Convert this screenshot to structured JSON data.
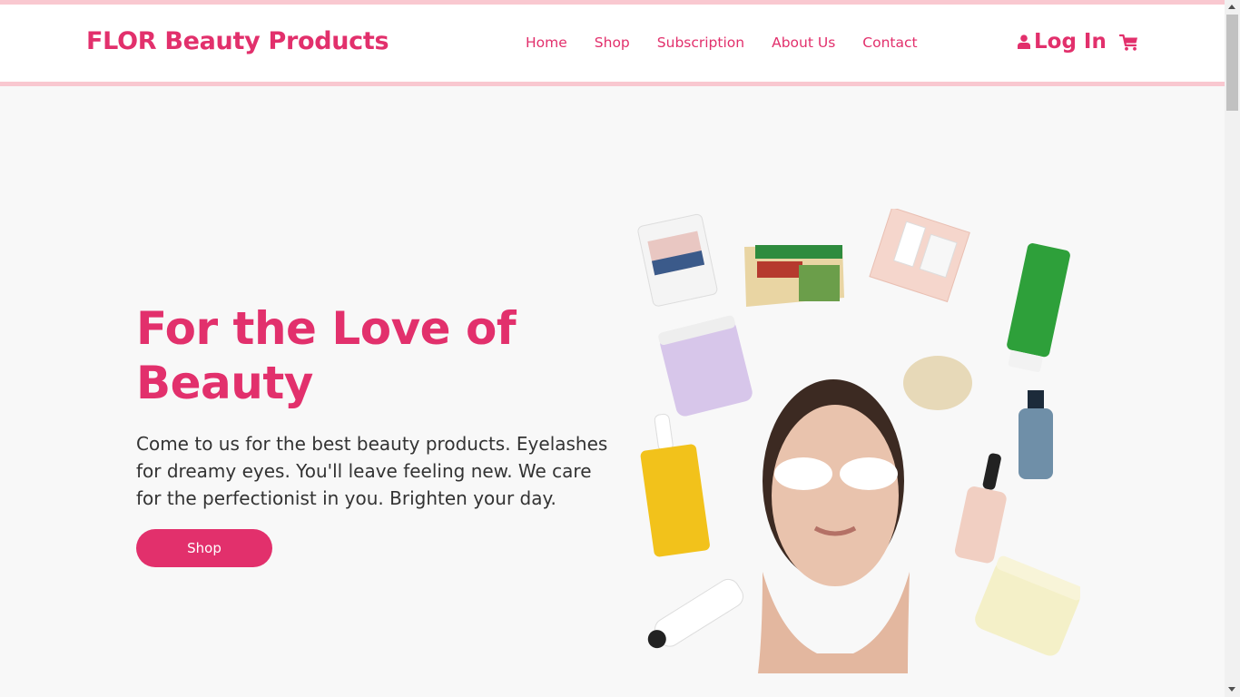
{
  "header": {
    "brand": "FLOR Beauty Products",
    "nav": [
      {
        "label": "Home"
      },
      {
        "label": "Shop"
      },
      {
        "label": "Subscription"
      },
      {
        "label": "About Us"
      },
      {
        "label": "Contact"
      }
    ],
    "login_label": "Log In"
  },
  "hero": {
    "title": "For the Love of Beauty",
    "description": "Come to us for the best beauty products. Eyelashes for dreamy eyes. You'll leave feeling new. We care for the perfectionist in you. Brighten your day.",
    "button_label": "Shop"
  },
  "colors": {
    "accent": "#e2306c",
    "strip": "#f9c8d0",
    "background": "#f8f8f8"
  },
  "icons": {
    "user": "user-icon",
    "cart": "cart-icon"
  }
}
